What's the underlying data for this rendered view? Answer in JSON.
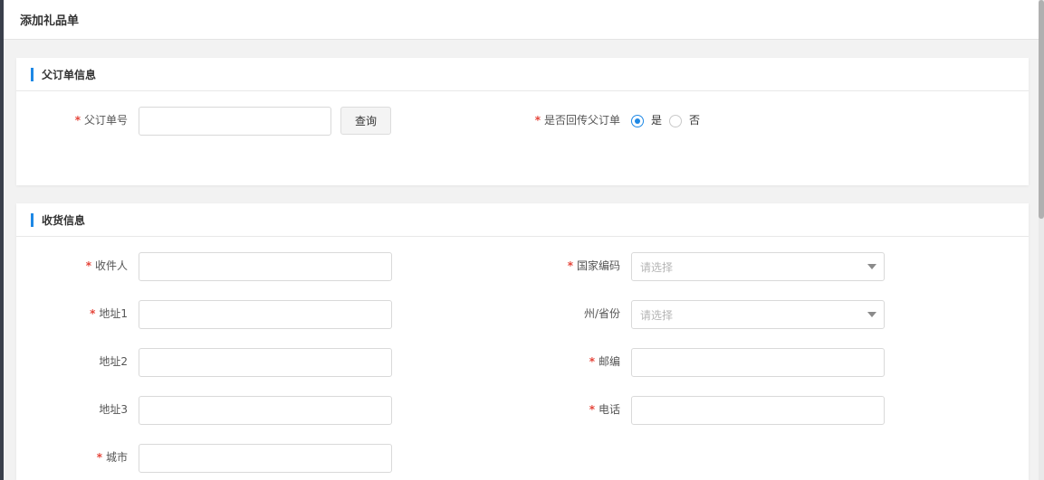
{
  "dialog": {
    "title": "添加礼品单"
  },
  "parent_order": {
    "section_title": "父订单信息",
    "order_no": {
      "label": "父订单号",
      "value": ""
    },
    "query_button": "查询",
    "return_parent": {
      "label": "是否回传父订单",
      "options": [
        {
          "label": "是",
          "selected": true
        },
        {
          "label": "否",
          "selected": false
        }
      ]
    }
  },
  "shipping": {
    "section_title": "收货信息",
    "recipient": {
      "label": "收件人",
      "value": ""
    },
    "address1": {
      "label": "地址1",
      "value": ""
    },
    "address2": {
      "label": "地址2",
      "value": ""
    },
    "address3": {
      "label": "地址3",
      "value": ""
    },
    "city": {
      "label": "城市",
      "value": ""
    },
    "country_code": {
      "label": "国家编码",
      "placeholder": "请选择"
    },
    "state_province": {
      "label": "州/省份",
      "placeholder": "请选择"
    },
    "postcode": {
      "label": "邮编",
      "value": ""
    },
    "phone": {
      "label": "电话",
      "value": ""
    }
  },
  "required_mark": "*",
  "colors": {
    "accent": "#1e88e5",
    "required": "#e5453a"
  }
}
